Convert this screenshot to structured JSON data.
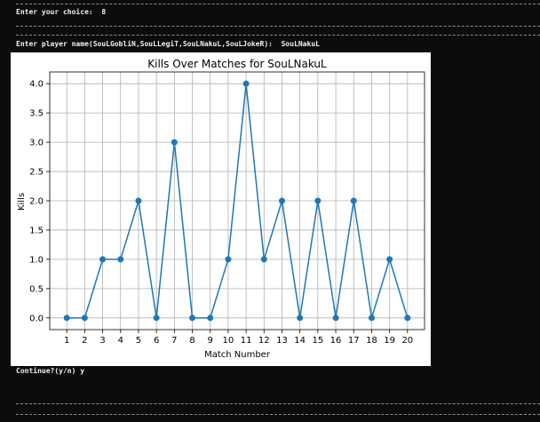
{
  "terminal": {
    "prompt_choice": "Enter your choice:  8",
    "prompt_player": "Enter player name(SouLGobliN,SouLLegiT,SouLNakuL,SouLJokeR):  SouLNakuL",
    "continue_prompt": "Continue?(y/n) y"
  },
  "chart_data": {
    "type": "line",
    "title": "Kills Over Matches for SouLNakuL",
    "xlabel": "Match Number",
    "ylabel": "Kills",
    "x": [
      1,
      2,
      3,
      4,
      5,
      6,
      7,
      8,
      9,
      10,
      11,
      12,
      13,
      14,
      15,
      16,
      17,
      18,
      19,
      20
    ],
    "series": [
      {
        "values": [
          0,
          0,
          1,
          1,
          2,
          0,
          3,
          0,
          0,
          1,
          4,
          1,
          2,
          0,
          2,
          0,
          2,
          0,
          1,
          0
        ]
      }
    ],
    "x_ticks": [
      "1",
      "2",
      "3",
      "4",
      "5",
      "6",
      "7",
      "8",
      "9",
      "10",
      "11",
      "12",
      "13",
      "14",
      "15",
      "16",
      "17",
      "18",
      "19",
      "20"
    ],
    "y_ticks": [
      "0.0",
      "0.5",
      "1.0",
      "1.5",
      "2.0",
      "2.5",
      "3.0",
      "3.5",
      "4.0"
    ],
    "xlim": [
      0.05,
      20.95
    ],
    "ylim": [
      -0.2,
      4.2
    ],
    "grid": true,
    "color": "#1f77b4",
    "marker": "circle"
  }
}
